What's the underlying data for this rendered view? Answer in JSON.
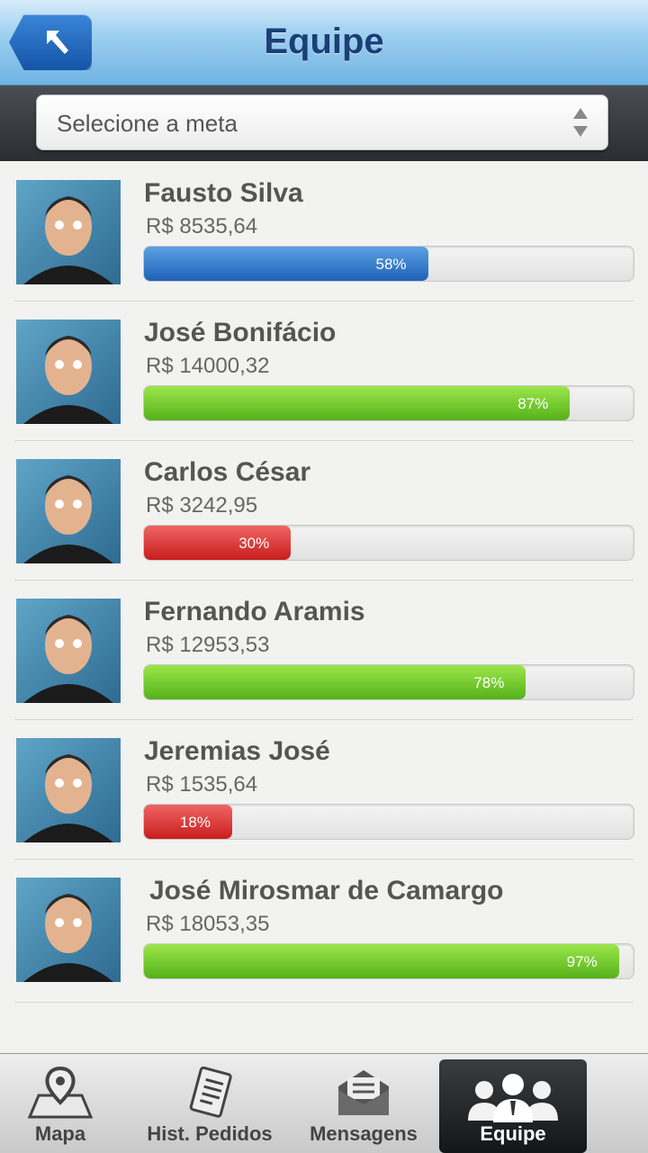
{
  "header": {
    "title": "Equipe",
    "back_icon": "back-arrow-icon"
  },
  "filter": {
    "placeholder": "Selecione a meta"
  },
  "team": [
    {
      "name": "Fausto Silva",
      "amount": "R$ 8535,64",
      "percent": 58,
      "percent_label": "58%",
      "color": "blue"
    },
    {
      "name": "José Bonifácio",
      "amount": "R$ 14000,32",
      "percent": 87,
      "percent_label": "87%",
      "color": "green"
    },
    {
      "name": "Carlos César",
      "amount": "R$ 3242,95",
      "percent": 30,
      "percent_label": "30%",
      "color": "red"
    },
    {
      "name": "Fernando Aramis",
      "amount": "R$ 12953,53",
      "percent": 78,
      "percent_label": "78%",
      "color": "green"
    },
    {
      "name": "Jeremias José",
      "amount": "R$ 1535,64",
      "percent": 18,
      "percent_label": "18%",
      "color": "red"
    },
    {
      "name": "José Mirosmar de Camargo",
      "amount": "R$ 18053,35",
      "percent": 97,
      "percent_label": "97%",
      "color": "green"
    }
  ],
  "tabs": [
    {
      "label": "Mapa",
      "icon": "map-pin-icon"
    },
    {
      "label": "Hist. Pedidos",
      "icon": "order-history-icon"
    },
    {
      "label": "Mensagens",
      "icon": "envelope-icon"
    },
    {
      "label": "Equipe",
      "icon": "team-icon",
      "active": true
    }
  ],
  "colors": {
    "blue": "#1f62b8",
    "green": "#55b21a",
    "red": "#c81e1e",
    "title": "#1b3f76"
  }
}
